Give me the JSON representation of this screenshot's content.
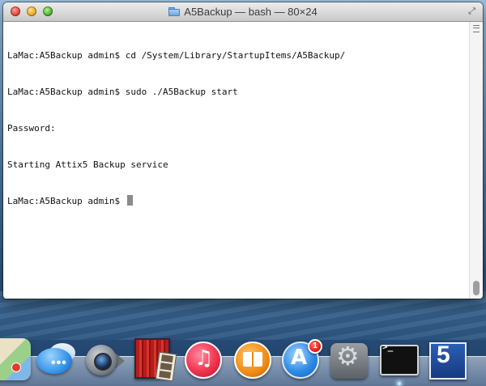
{
  "window": {
    "title": "A5Backup — bash — 80×24",
    "folder_icon": "folder-icon",
    "fullscreen_icon": "fullscreen-arrows-icon"
  },
  "terminal": {
    "lines": [
      "LaMac:A5Backup admin$ cd /System/Library/StartupItems/A5Backup/",
      "LaMac:A5Backup admin$ sudo ./A5Backup start",
      "Password:",
      "Starting Attix5 Backup service",
      "LaMac:A5Backup admin$ "
    ]
  },
  "dock": {
    "items": [
      {
        "name": "maps",
        "icon": "maps-icon"
      },
      {
        "name": "messages",
        "icon": "messages-icon"
      },
      {
        "name": "facetime",
        "icon": "facetime-icon"
      },
      {
        "name": "photo-booth",
        "icon": "photo-booth-icon"
      },
      {
        "name": "itunes",
        "icon": "itunes-icon"
      },
      {
        "name": "ibooks",
        "icon": "ibooks-icon"
      },
      {
        "name": "app-store",
        "icon": "app-store-icon",
        "badge": "1"
      },
      {
        "name": "system-preferences",
        "icon": "system-preferences-icon"
      },
      {
        "name": "terminal",
        "icon": "terminal-icon",
        "glyph": ">_"
      },
      {
        "name": "five",
        "icon": "five-icon",
        "glyph": "5"
      }
    ]
  },
  "colors": {
    "terminal_bg": "#ffffff",
    "terminal_text": "#111111",
    "cursor": "#8a8a8a",
    "badge": "#e0241a"
  }
}
